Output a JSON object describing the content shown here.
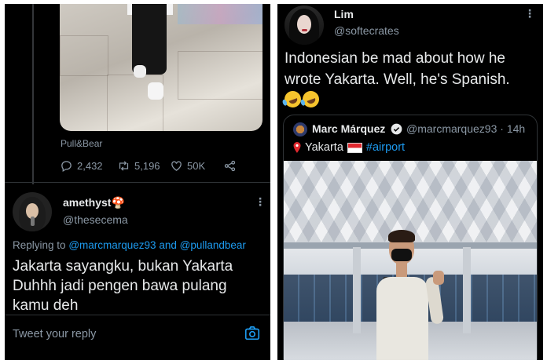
{
  "left_panel": {
    "quoted_post": {
      "source": "Pull&Bear",
      "actions": {
        "replies": "2,432",
        "retweets": "5,196",
        "likes": "50K"
      }
    },
    "reply": {
      "author_name": "amethyst🍄",
      "author_handle": "@thesecema",
      "replying_to_prefix": "Replying to",
      "replying_to_1": "@marcmarquez93",
      "replying_to_and": "and",
      "replying_to_2": "@pullandbear",
      "text_line1": "Jakarta sayangku, bukan Yakarta",
      "text_line2": "Duhhh jadi pengen bawa pulang",
      "text_line3": "kamu deh"
    },
    "reply_bar": {
      "placeholder": "Tweet your reply"
    }
  },
  "right_panel": {
    "author_name": "Lim",
    "author_handle": "@softecrates",
    "tweet_line1": "Indonesian be mad about how he",
    "tweet_line2": "wrote Yakarta. Well, he's Spanish.",
    "quoted_tweet": {
      "author_name": "Marc Márquez",
      "author_handle": "@marcmarquez93",
      "separator": "·",
      "time": "14h",
      "location_text": "Yakarta",
      "hashtag": "#airport"
    }
  },
  "colors": {
    "background": "#000000",
    "accent": "#1d9bf0",
    "secondary_text": "#8b98a5",
    "primary_text": "#e7e9ea"
  },
  "icons": [
    "reply-icon",
    "retweet-icon",
    "like-icon",
    "share-icon",
    "more-icon",
    "camera-icon",
    "verified-icon",
    "pin-icon",
    "indonesia-flag-icon",
    "rofl-emoji-icon"
  ]
}
